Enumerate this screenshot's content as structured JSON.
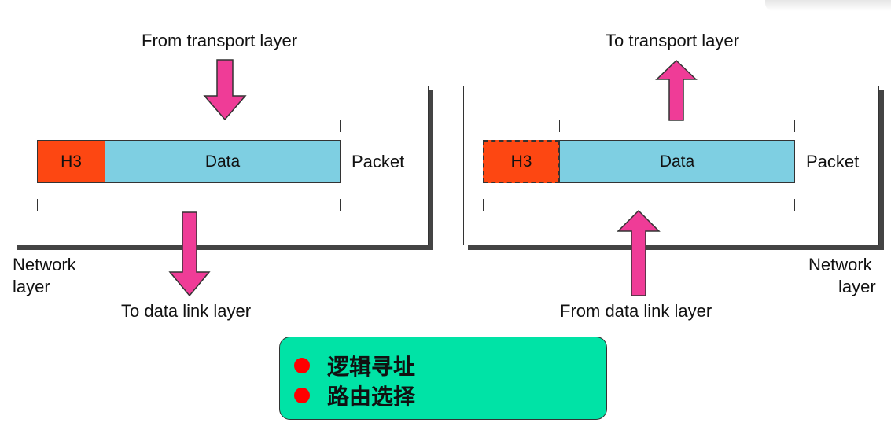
{
  "sender": {
    "top_label": "From transport layer",
    "bottom_label": "To data link layer",
    "header": "H3",
    "data": "Data",
    "packet": "Packet",
    "layer_line1": "Network",
    "layer_line2": "layer"
  },
  "receiver": {
    "top_label": "To transport layer",
    "bottom_label": "From data link layer",
    "header": "H3",
    "data": "Data",
    "packet": "Packet",
    "layer_line1": "Network",
    "layer_line2": "layer"
  },
  "note": {
    "items": [
      "逻辑寻址",
      "路由选择"
    ]
  },
  "colors": {
    "header": "#fd4712",
    "data": "#7ecfe2",
    "arrow": "#ef3c97",
    "note_bg": "#00e3a6",
    "bullet": "#ff0000"
  }
}
